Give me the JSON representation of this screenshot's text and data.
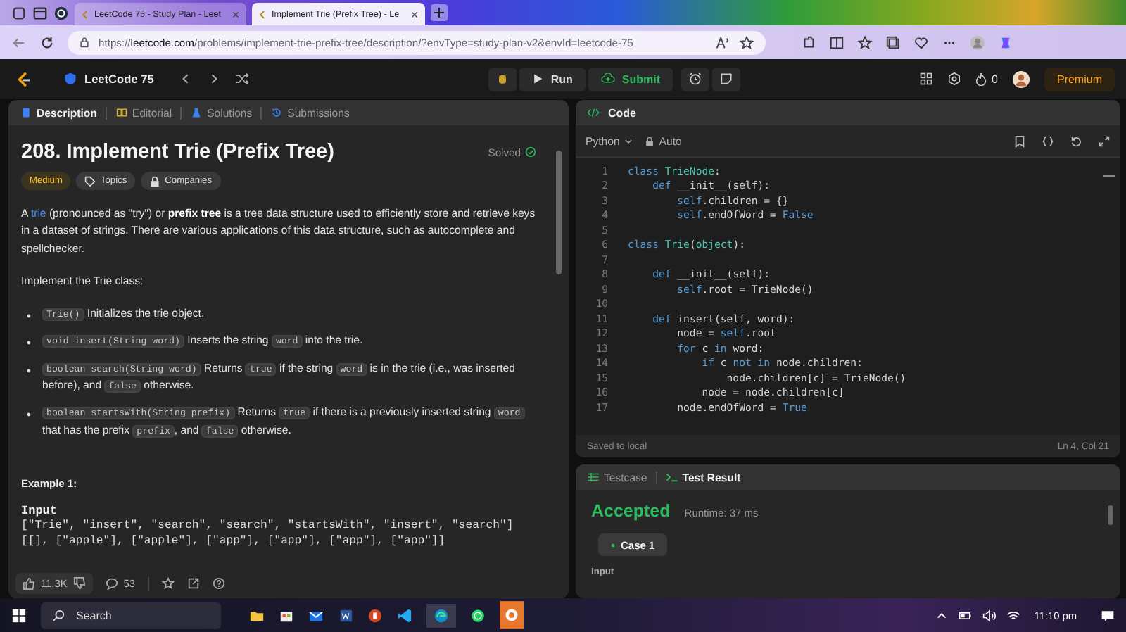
{
  "browser": {
    "tabs": [
      {
        "title": "LeetCode 75 - Study Plan - Leet",
        "selected": false
      },
      {
        "title": "Implement Trie (Prefix Tree) - Le",
        "selected": true
      }
    ],
    "url": "https://**leetcode.com**/problems/implement-trie-prefix-tree/description/?envType=study-plan-v2&envId=leetcode-75"
  },
  "nav": {
    "study_plan": "LeetCode 75",
    "run": "Run",
    "submit": "Submit",
    "streak": "0",
    "premium": "Premium"
  },
  "description_tabs": [
    {
      "label": "Description",
      "selected": true
    },
    {
      "label": "Editorial",
      "selected": false
    },
    {
      "label": "Solutions",
      "selected": false
    },
    {
      "label": "Submissions",
      "selected": false
    }
  ],
  "problem": {
    "title": "208. Implement Trie (Prefix Tree)",
    "status": "Solved",
    "difficulty": "Medium",
    "tags": [
      {
        "label": "Topics",
        "kind": "tag"
      },
      {
        "label": "Companies",
        "kind": "lock"
      }
    ],
    "intro": [
      {
        "kind": "text",
        "text": "A "
      },
      {
        "kind": "link",
        "text": "trie"
      },
      {
        "kind": "text",
        "text": " (pronounced as \"try\") or "
      },
      {
        "kind": "bold",
        "text": "prefix tree"
      },
      {
        "kind": "text",
        "text": " is a tree data structure used to efficiently store and retrieve keys in a dataset of strings. There are various applications of this data structure, such as autocomplete and spellchecker."
      }
    ],
    "class_intro": "Implement the Trie class:",
    "methods": [
      [
        {
          "kind": "code",
          "text": "Trie()"
        },
        {
          "kind": "text",
          "text": " Initializes the trie object."
        }
      ],
      [
        {
          "kind": "code",
          "text": "void insert(String word)"
        },
        {
          "kind": "text",
          "text": " Inserts the string "
        },
        {
          "kind": "code",
          "text": "word"
        },
        {
          "kind": "text",
          "text": " into the trie."
        }
      ],
      [
        {
          "kind": "code",
          "text": "boolean search(String word)"
        },
        {
          "kind": "text",
          "text": " Returns "
        },
        {
          "kind": "code",
          "text": "true"
        },
        {
          "kind": "text",
          "text": " if the string "
        },
        {
          "kind": "code",
          "text": "word"
        },
        {
          "kind": "text",
          "text": " is in the trie (i.e., was inserted before), and "
        },
        {
          "kind": "code",
          "text": "false"
        },
        {
          "kind": "text",
          "text": " otherwise."
        }
      ],
      [
        {
          "kind": "code",
          "text": "boolean startsWith(String prefix)"
        },
        {
          "kind": "text",
          "text": " Returns "
        },
        {
          "kind": "code",
          "text": "true"
        },
        {
          "kind": "text",
          "text": " if there is a previously inserted string "
        },
        {
          "kind": "code",
          "text": "word"
        },
        {
          "kind": "text",
          "text": " that has the prefix "
        },
        {
          "kind": "code",
          "text": "prefix"
        },
        {
          "kind": "text",
          "text": ", and "
        },
        {
          "kind": "code",
          "text": "false"
        },
        {
          "kind": "text",
          "text": " otherwise."
        }
      ]
    ],
    "example_heading": "Example 1:",
    "input_label": "Input",
    "input_lines": [
      "[\"Trie\", \"insert\", \"search\", \"search\", \"startsWith\", \"insert\", \"search\"]",
      "[[], [\"apple\"], [\"apple\"], [\"app\"], [\"app\"], [\"app\"], [\"app\"]]"
    ]
  },
  "footer": {
    "likes": "11.3K",
    "comments": "53"
  },
  "code": {
    "title": "Code",
    "language": "Python",
    "mode": "Auto",
    "lines": [
      {
        "number": "1",
        "tokens": [
          {
            "kind": "kw",
            "text": "class "
          },
          {
            "kind": "cls",
            "text": "TrieNode"
          },
          {
            "kind": "plain",
            "text": ":"
          }
        ]
      },
      {
        "number": "2",
        "tokens": [
          {
            "kind": "kw",
            "text": "    def"
          },
          {
            "kind": "plain",
            "text": " __init__(self):"
          }
        ]
      },
      {
        "number": "3",
        "tokens": [
          {
            "kind": "self",
            "text": "        self"
          },
          {
            "kind": "plain",
            "text": ".children = {}"
          }
        ]
      },
      {
        "number": "4",
        "tokens": [
          {
            "kind": "self",
            "text": "        self"
          },
          {
            "kind": "plain",
            "text": ".endOfWord = "
          },
          {
            "kind": "const",
            "text": "False"
          }
        ]
      },
      {
        "number": "5"
      },
      {
        "number": "6",
        "tokens": [
          {
            "kind": "kw",
            "text": "class "
          },
          {
            "kind": "cls",
            "text": "Trie"
          },
          {
            "kind": "plain",
            "text": "("
          },
          {
            "kind": "cls",
            "text": "object"
          },
          {
            "kind": "plain",
            "text": "):"
          }
        ]
      },
      {
        "number": "7"
      },
      {
        "number": "8",
        "tokens": [
          {
            "kind": "kw",
            "text": "    def"
          },
          {
            "kind": "plain",
            "text": " __init__(self):"
          }
        ]
      },
      {
        "number": "9",
        "tokens": [
          {
            "kind": "self",
            "text": "        self"
          },
          {
            "kind": "plain",
            "text": ".root = TrieNode()"
          }
        ]
      },
      {
        "number": "10"
      },
      {
        "number": "11",
        "tokens": [
          {
            "kind": "kw",
            "text": "    def"
          },
          {
            "kind": "plain",
            "text": " insert(self, word):"
          }
        ]
      },
      {
        "number": "12",
        "tokens": [
          {
            "kind": "plain",
            "text": "        node = "
          },
          {
            "kind": "self",
            "text": "self"
          },
          {
            "kind": "plain",
            "text": ".root"
          }
        ]
      },
      {
        "number": "13",
        "tokens": [
          {
            "kind": "kw",
            "text": "        for"
          },
          {
            "kind": "plain",
            "text": " c "
          },
          {
            "kind": "kw",
            "text": "in"
          },
          {
            "kind": "plain",
            "text": " word:"
          }
        ]
      },
      {
        "number": "14",
        "tokens": [
          {
            "kind": "kw",
            "text": "            if"
          },
          {
            "kind": "plain",
            "text": " c "
          },
          {
            "kind": "kw",
            "text": "not in"
          },
          {
            "kind": "plain",
            "text": " node.children:"
          }
        ]
      },
      {
        "number": "15",
        "tokens": [
          {
            "kind": "plain",
            "text": "                node.children[c] = TrieNode()"
          }
        ]
      },
      {
        "number": "16",
        "tokens": [
          {
            "kind": "plain",
            "text": "            node = node.children[c]"
          }
        ]
      },
      {
        "number": "17",
        "tokens": [
          {
            "kind": "plain",
            "text": "        node.endOfWord = "
          },
          {
            "kind": "const",
            "text": "True"
          }
        ]
      }
    ],
    "status": "Saved to local",
    "cursor": "Ln 4, Col 21"
  },
  "result": {
    "tabs": [
      {
        "label": "Testcase",
        "selected": false
      },
      {
        "label": "Test Result",
        "selected": true
      }
    ],
    "verdict": "Accepted",
    "runtime": "Runtime: 37 ms",
    "cases": [
      {
        "label": "Case 1",
        "selected": true
      }
    ],
    "input_label": "Input"
  },
  "taskbar": {
    "search": "Search",
    "time": "11:10 pm"
  }
}
